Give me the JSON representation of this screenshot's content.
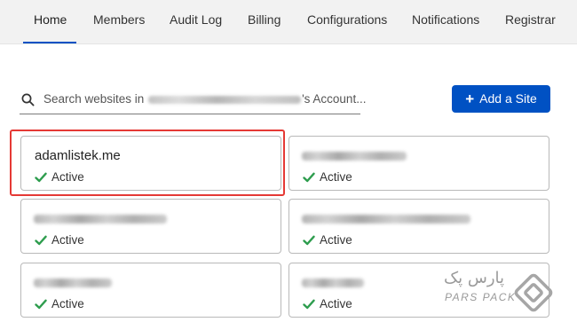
{
  "tabs": [
    {
      "label": "Home",
      "active": true
    },
    {
      "label": "Members"
    },
    {
      "label": "Audit Log"
    },
    {
      "label": "Billing"
    },
    {
      "label": "Configurations"
    },
    {
      "label": "Notifications"
    },
    {
      "label": "Registrar"
    }
  ],
  "search": {
    "prefix": "Search websites in",
    "suffix": "'s Account..."
  },
  "add_site": {
    "label": "Add a Site"
  },
  "sites": [
    {
      "name": "adamlistek.me",
      "status": "Active",
      "highlighted": true
    },
    {
      "name": "",
      "status": "Active"
    },
    {
      "name": "",
      "status": "Active"
    },
    {
      "name": "",
      "status": "Active"
    },
    {
      "name": "",
      "status": "Active"
    },
    {
      "name": "",
      "status": "Active"
    }
  ],
  "watermark": {
    "text_ar": "پارس پک",
    "text_en": "PARS PACK"
  },
  "colors": {
    "accent": "#0051c3",
    "success": "#2e9d4e",
    "highlight": "#e53935"
  }
}
